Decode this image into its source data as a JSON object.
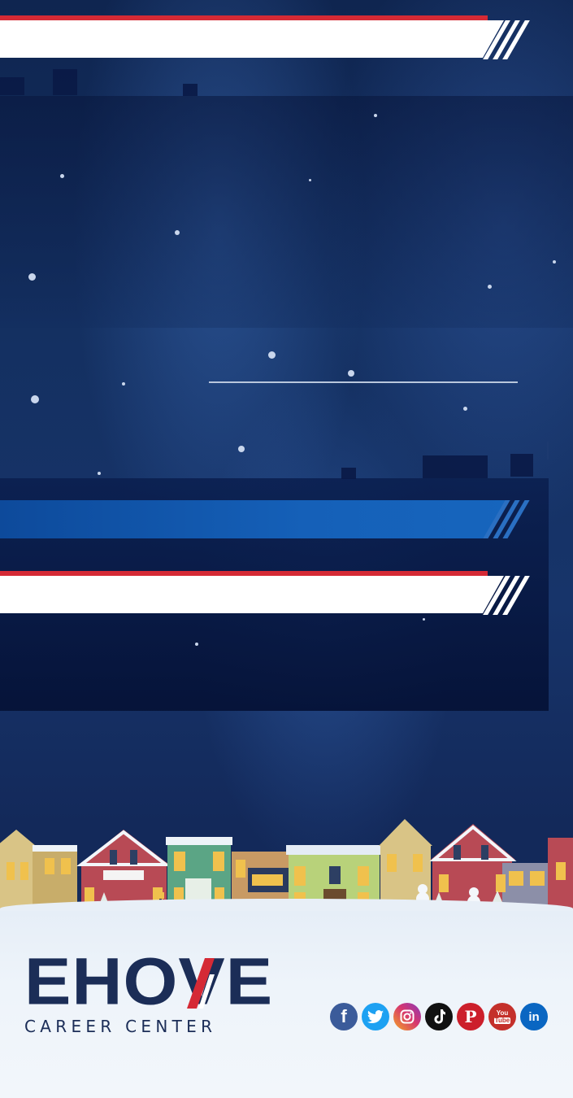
{
  "logo": {
    "main_text": "EHOVE",
    "sub_text": "CAREER CENTER"
  },
  "socials": [
    {
      "name": "facebook-icon",
      "glyph": "f",
      "color": "#3b5b9a"
    },
    {
      "name": "twitter-icon",
      "glyph": "🐦",
      "color": "#1da1f2"
    },
    {
      "name": "instagram-icon",
      "glyph": "◎",
      "color": "#d6366f"
    },
    {
      "name": "tiktok-icon",
      "glyph": "♪",
      "color": "#111111"
    },
    {
      "name": "pinterest-icon",
      "glyph": "P",
      "color": "#cc1f2b"
    },
    {
      "name": "youtube-icon",
      "glyph": "You Tube",
      "color": "#c4302b"
    },
    {
      "name": "linkedin-icon",
      "glyph": "in",
      "color": "#0a66c2"
    }
  ],
  "colors": {
    "brand_navy": "#1b2d57",
    "accent_red": "#d52a35",
    "sky": "#143061"
  }
}
